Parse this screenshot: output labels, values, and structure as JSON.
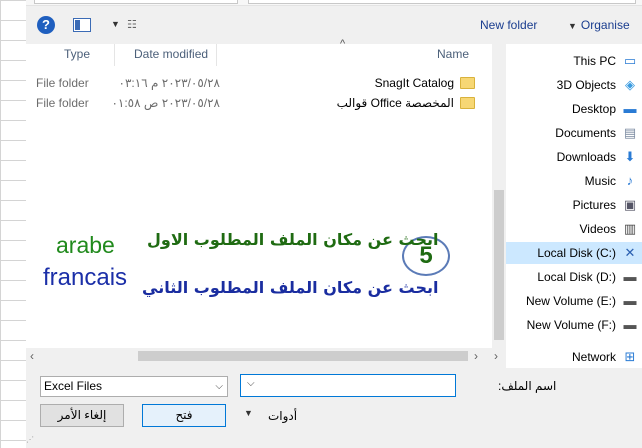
{
  "toolbar": {
    "help": "?",
    "new_folder": "New folder",
    "organise": "Organise"
  },
  "columns": {
    "type": "Type",
    "date_modified": "Date modified",
    "name": "Name"
  },
  "files": [
    {
      "type": "File folder",
      "date": "٢٠٢٣/٠٥/٢٨ م ٠٣:١٦",
      "name": "SnagIt Catalog"
    },
    {
      "type": "File folder",
      "date": "٢٠٢٣/٠٥/٢٨ ص ٠١:٥٨",
      "name": "قوالب Office المخصصة"
    }
  ],
  "nav": [
    {
      "label": "This PC",
      "icon": "computer-icon"
    },
    {
      "label": "3D Objects",
      "icon": "cube-icon"
    },
    {
      "label": "Desktop",
      "icon": "desktop-icon"
    },
    {
      "label": "Documents",
      "icon": "document-icon"
    },
    {
      "label": "Downloads",
      "icon": "download-icon"
    },
    {
      "label": "Music",
      "icon": "music-icon"
    },
    {
      "label": "Pictures",
      "icon": "picture-icon"
    },
    {
      "label": "Videos",
      "icon": "video-icon"
    },
    {
      "label": "Local Disk (C:)",
      "icon": "drive-icon",
      "selected": true
    },
    {
      "label": "Local Disk (D:)",
      "icon": "drive-icon"
    },
    {
      "label": "New Volume (E:)",
      "icon": "drive-icon"
    },
    {
      "label": "New Volume (F:)",
      "icon": "drive-icon"
    },
    {
      "label": "Network",
      "icon": "network-icon"
    }
  ],
  "annotation": {
    "step": "5",
    "arabic_line1": "ابحث عن مكان الملف المطلوب الاول",
    "arabic_line2": "ابحث عن مكان الملف المطلوب الثاني",
    "arabe": "arabe",
    "francais": "francais"
  },
  "bottom": {
    "file_type": "Excel Files",
    "filename_label": "اسم الملف:",
    "filename_value": "",
    "tools_label": "أدوات",
    "open_button": "فتح",
    "cancel_button": "إلغاء الأمر"
  },
  "colors": {
    "accent": "#0078d7",
    "selected_bg": "#cce8ff",
    "annotation_green": "#1f6b12",
    "annotation_blue": "#1a2da0"
  }
}
